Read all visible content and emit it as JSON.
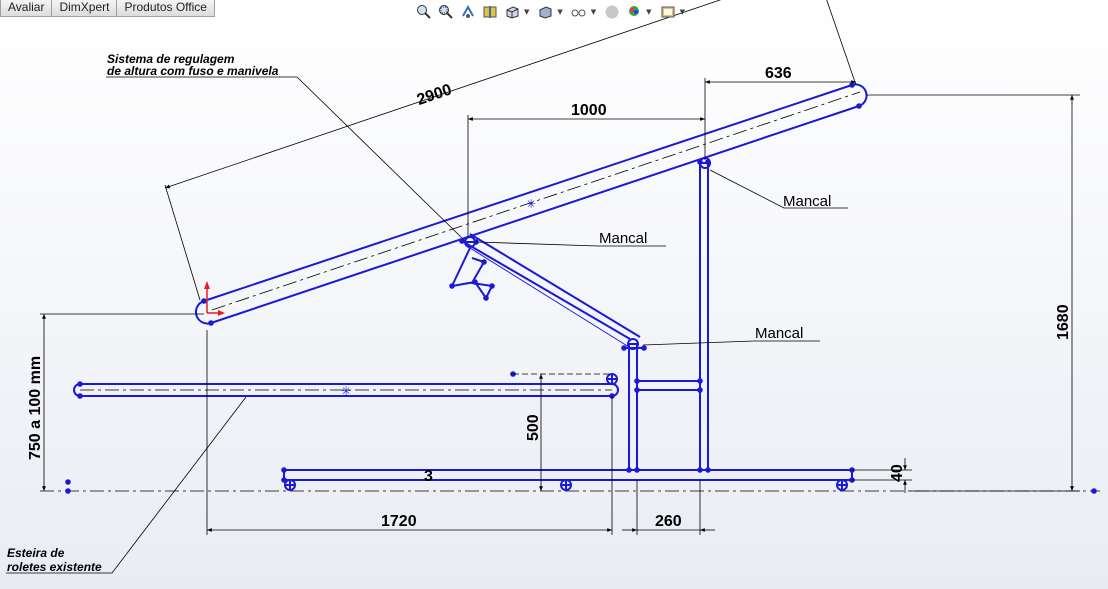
{
  "menu_tabs": [
    "Avaliar",
    "DimXpert",
    "Produtos Office"
  ],
  "view_toolbar": {
    "icons": [
      "zoom-to-fit-icon",
      "zoom-to-area-icon",
      "previous-view-icon",
      "section-view-icon",
      "view-orientation-icon",
      "display-style-icon",
      "hide-show-items-icon",
      "edit-appearance-icon",
      "apply-scene-icon",
      "view-settings-icon"
    ]
  },
  "colors": {
    "geometry": "#1a1ad6",
    "dimension": "#000000",
    "origin_x": "#e02020",
    "origin_y": "#e02020"
  },
  "annotations": {
    "sistema_line1": "Sistema de regulagem",
    "sistema_line2": "de altura com fuso e manivela",
    "esteira_line1": "Esteira de",
    "esteira_line2": "roletes existente",
    "mancal_1": "Mancal",
    "mancal_2": "Mancal",
    "mancal_3": "Mancal"
  },
  "dimensions": {
    "d2900": "2900",
    "d636": "636",
    "d1000": "1000",
    "d1680": "1680",
    "d750": "750 a 100 mm",
    "d500": "500",
    "d3": "3",
    "d40": "40",
    "d1720": "1720",
    "d260": "260"
  }
}
